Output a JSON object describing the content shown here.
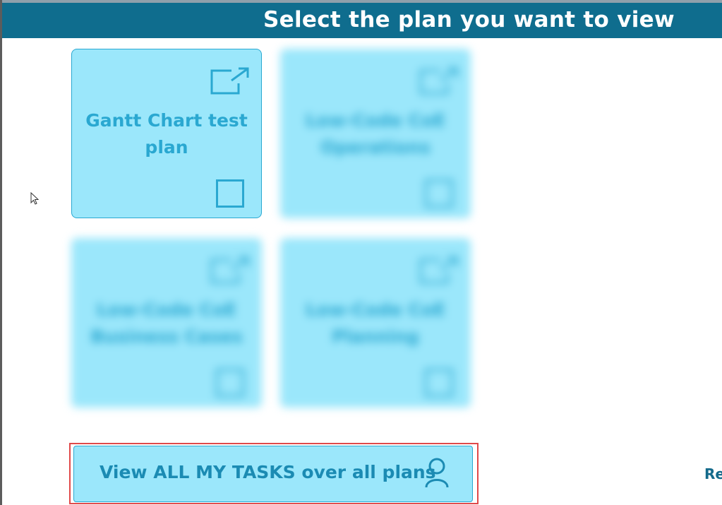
{
  "header": {
    "title": "Select the plan you want to view"
  },
  "plans": [
    {
      "label": "Gantt Chart test plan",
      "blurred": false
    },
    {
      "label": "Low-Code CoE Operations",
      "blurred": true
    },
    {
      "label": "Low-Code CoE Business Cases",
      "blurred": true
    },
    {
      "label": "Low-Code CoE Planning",
      "blurred": true
    }
  ],
  "tasks_button": {
    "label": "View ALL MY TASKS over all plans",
    "icon": "person-icon"
  },
  "refresh": {
    "label": "Re"
  },
  "colors": {
    "header_bg": "#0f6d8e",
    "tile_bg": "#9be7fb",
    "accent": "#2aa8d1",
    "highlight_border": "#e0494a"
  }
}
